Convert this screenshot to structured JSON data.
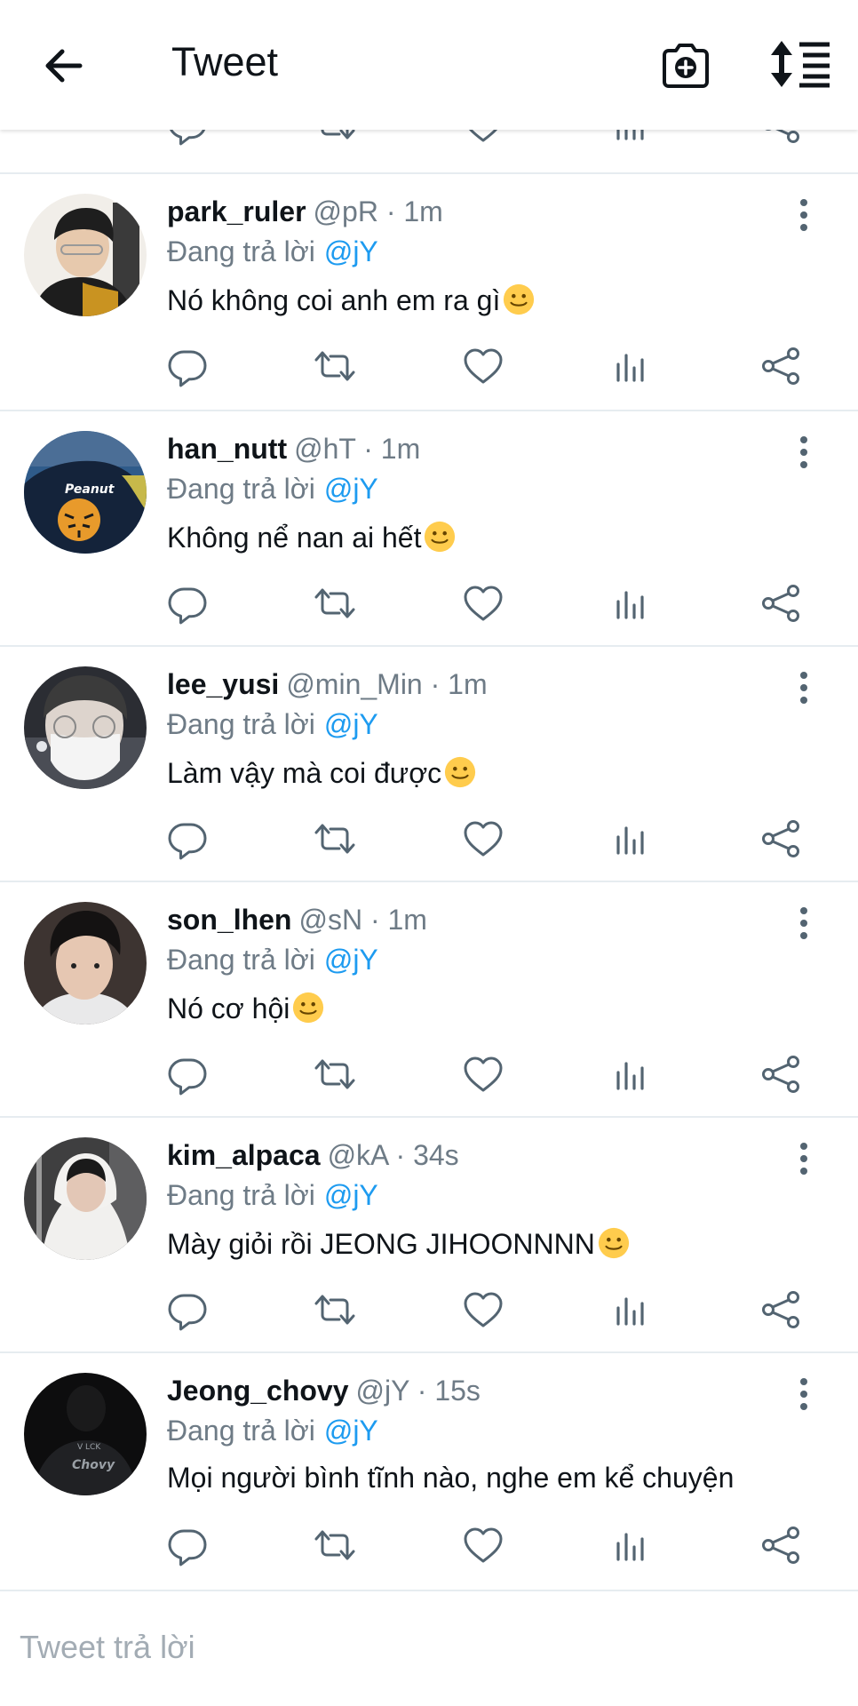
{
  "header": {
    "title": "Tweet",
    "back_icon": "arrow-left-icon",
    "camera_icon": "camera-plus-icon",
    "sort_icon": "sort-icon"
  },
  "colors": {
    "accent": "#1d9bf0",
    "secondary_text": "#6e7b86",
    "divider": "#e6ecf0",
    "icon": "#536471"
  },
  "tweets": [
    {
      "name": "park_ruler",
      "handle": "@pR · 1m",
      "reply_prefix": "Đang trả lời",
      "reply_to": "@jY",
      "text": "Nó không coi anh em ra gì",
      "emoji": "slightly-smiling-face"
    },
    {
      "name": "han_nutt",
      "handle": "@hT · 1m",
      "reply_prefix": "Đang trả lời",
      "reply_to": "@jY",
      "text": "Không nể nan ai hết",
      "emoji": "slightly-smiling-face"
    },
    {
      "name": "lee_yusi",
      "handle": "@min_Min · 1m",
      "reply_prefix": "Đang trả lời",
      "reply_to": "@jY",
      "text": "Làm vậy mà coi được",
      "emoji": "slightly-smiling-face"
    },
    {
      "name": "son_lhen",
      "handle": "@sN · 1m",
      "reply_prefix": "Đang trả lời",
      "reply_to": "@jY",
      "text": "Nó cơ hội",
      "emoji": "slightly-smiling-face"
    },
    {
      "name": "kim_alpaca",
      "handle": "@kA · 34s",
      "reply_prefix": "Đang trả lời",
      "reply_to": "@jY",
      "text": "Mày giỏi rồi JEONG JIHOONNNN",
      "emoji": "slightly-smiling-face"
    },
    {
      "name": "Jeong_chovy",
      "handle": "@jY · 15s",
      "reply_prefix": "Đang trả lời",
      "reply_to": "@jY",
      "text": "Mọi người bình tĩnh nào, nghe em kể chuyện",
      "emoji": ""
    }
  ],
  "actions": [
    "reply-icon",
    "retweet-icon",
    "like-icon",
    "stats-icon",
    "share-icon"
  ],
  "compose": {
    "placeholder": "Tweet trả lời",
    "value": ""
  }
}
